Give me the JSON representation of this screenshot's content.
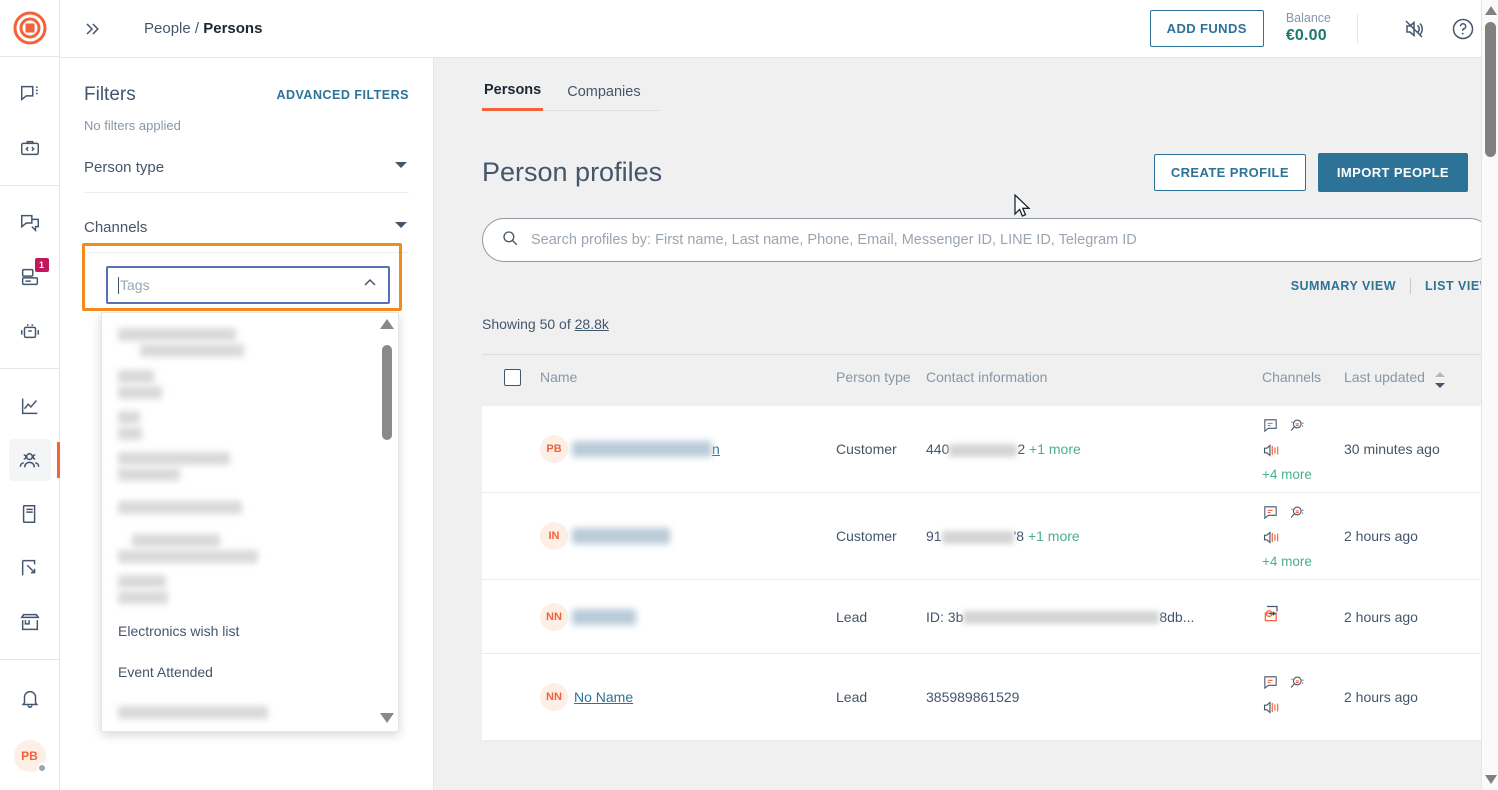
{
  "brand": {
    "accent": "#f4623a",
    "teal": "#2d7297",
    "green": "#4caf8f",
    "highlight": "#f08c1a"
  },
  "rail": {
    "logo_name": "app-logo",
    "items": [
      {
        "name": "chat-icon",
        "badge": ""
      },
      {
        "name": "developer-toolbox-icon",
        "badge": ""
      },
      {
        "name": "broadcast-icon",
        "badge": ""
      },
      {
        "name": "inbox-icon",
        "badge": "1"
      },
      {
        "name": "bot-icon",
        "badge": ""
      },
      {
        "name": "analytics-icon",
        "badge": ""
      },
      {
        "name": "people-icon",
        "badge": ""
      },
      {
        "name": "catalog-icon",
        "badge": ""
      },
      {
        "name": "flows-icon",
        "badge": ""
      },
      {
        "name": "store-icon",
        "badge": ""
      }
    ],
    "bell_name": "notifications-bell-icon",
    "avatar_initials": "PB"
  },
  "topbar": {
    "expand_icon": "double-chevron-right-icon",
    "breadcrumb_parent": "People",
    "breadcrumb_separator": "/",
    "breadcrumb_current": "Persons",
    "add_funds_label": "ADD FUNDS",
    "balance_label": "Balance",
    "balance_value": "€0.00",
    "mute_icon": "speaker-muted-icon",
    "help_icon": "help-circle-icon"
  },
  "filters": {
    "title": "Filters",
    "advanced_label": "ADVANCED FILTERS",
    "status": "No filters applied",
    "rows": [
      {
        "label": "Person type"
      },
      {
        "label": "Channels"
      }
    ],
    "tags": {
      "placeholder": "Tags",
      "chevron_icon": "chevron-up-icon",
      "options": [
        {
          "label": "",
          "redacted": true,
          "widths": [
            118,
            104
          ]
        },
        {
          "label": "",
          "redacted": true,
          "widths": [
            36,
            44
          ]
        },
        {
          "label": "",
          "redacted": true,
          "widths": [
            22,
            24
          ]
        },
        {
          "label": "",
          "redacted": true,
          "widths": [
            112,
            62
          ]
        },
        {
          "label": "",
          "redacted": true,
          "widths": [
            124,
            0
          ]
        },
        {
          "label": "",
          "redacted": true,
          "widths": [
            88,
            140
          ]
        },
        {
          "label": "",
          "redacted": true,
          "widths": [
            48,
            50
          ]
        },
        {
          "label": "Electronics wish list",
          "redacted": false,
          "widths": [
            0,
            0
          ]
        },
        {
          "label": "Event Attended",
          "redacted": false,
          "widths": [
            0,
            0
          ]
        },
        {
          "label": "",
          "redacted": true,
          "widths": [
            150,
            0
          ]
        }
      ]
    }
  },
  "main": {
    "tabs": [
      {
        "label": "Persons",
        "active": true
      },
      {
        "label": "Companies",
        "active": false
      }
    ],
    "title": "Person profiles",
    "create_label": "CREATE PROFILE",
    "import_label": "IMPORT PEOPLE",
    "search_placeholder": "Search profiles by: First name, Last name, Phone, Email, Messenger ID, LINE ID, Telegram ID",
    "search_icon": "search-icon",
    "summary_view_label": "SUMMARY VIEW",
    "list_view_label": "LIST VIEW",
    "showing_prefix": "Showing 50 of",
    "showing_total": "28.8k",
    "columns": {
      "name": "Name",
      "person_type": "Person type",
      "contact": "Contact information",
      "channels": "Channels",
      "last_updated": "Last updated"
    },
    "sort_icon": "sort-arrows-icon",
    "rows": [
      {
        "initials": "PB",
        "name_redacted": true,
        "name_visible_suffix": "n",
        "name_blur_width": 140,
        "person_type": "Customer",
        "contact_prefix": "440",
        "contact_blur_width": 68,
        "contact_suffix": "2",
        "contact_more": "+1 more",
        "channels": [
          "note-icon",
          "search-person-icon",
          "broadcast-speaker-icon"
        ],
        "channels_more": "+4 more",
        "last_updated": "30 minutes ago"
      },
      {
        "initials": "IN",
        "name_redacted": true,
        "name_visible_suffix": "",
        "name_blur_width": 98,
        "person_type": "Customer",
        "contact_prefix": "91",
        "contact_blur_width": 72,
        "contact_suffix": "'8",
        "contact_more": "+1 more",
        "channels": [
          "note-icon",
          "search-person-icon",
          "broadcast-speaker-icon"
        ],
        "channels_more": "+4 more",
        "last_updated": "2 hours ago"
      },
      {
        "initials": "NN",
        "name_redacted": true,
        "name_visible_suffix": "",
        "name_blur_width": 64,
        "person_type": "Lead",
        "contact_prefix": "ID: 3b",
        "contact_blur_width": 196,
        "contact_suffix": "8db...",
        "contact_more": "",
        "channels": [
          "email-reply-icon"
        ],
        "channels_more": "",
        "last_updated": "2 hours ago"
      },
      {
        "initials": "NN",
        "name_redacted": false,
        "name_text": "No Name",
        "person_type": "Lead",
        "contact_prefix": "385989861529",
        "contact_blur_width": 0,
        "contact_suffix": "",
        "contact_more": "",
        "channels": [
          "note-icon",
          "search-person-icon",
          "broadcast-speaker-icon"
        ],
        "channels_more": "",
        "last_updated": "2 hours ago"
      }
    ]
  },
  "scrollbar": {
    "up_icon": "scroll-up-arrow-icon",
    "down_icon": "scroll-down-arrow-icon"
  },
  "cursor": {
    "name": "mouse-pointer"
  }
}
